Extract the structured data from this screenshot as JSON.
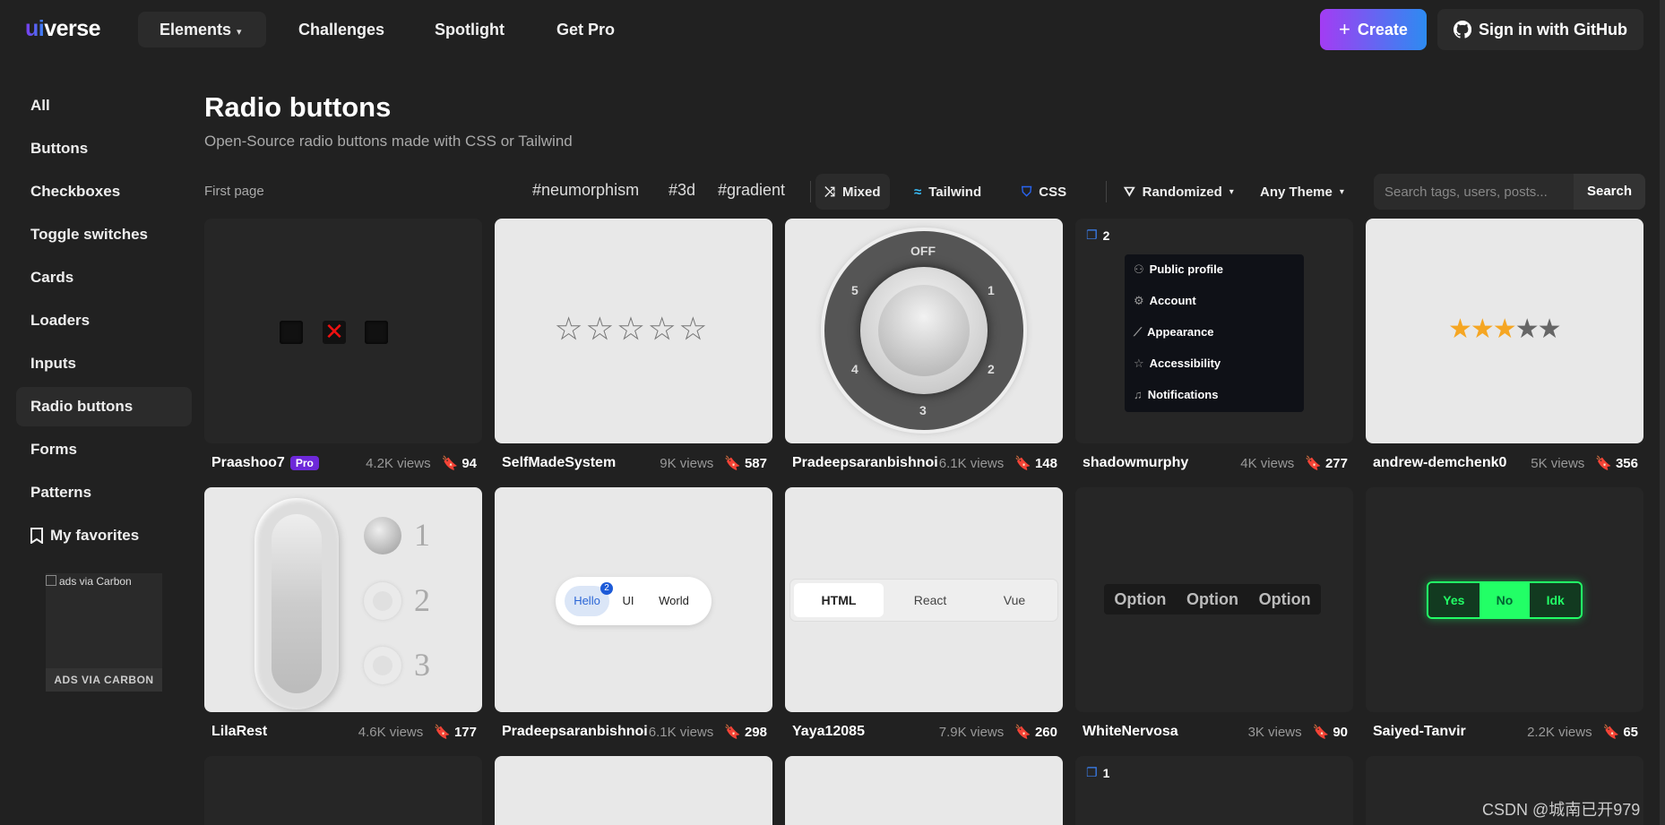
{
  "brand": {
    "logo_u": "ui",
    "logo_rest": "verse"
  },
  "nav": {
    "elements": "Elements",
    "challenges": "Challenges",
    "spotlight": "Spotlight",
    "getpro": "Get Pro"
  },
  "header": {
    "create": "Create",
    "github": "Sign in with GitHub"
  },
  "sidebar": {
    "items": [
      "All",
      "Buttons",
      "Checkboxes",
      "Toggle switches",
      "Cards",
      "Loaders",
      "Inputs",
      "Radio buttons",
      "Forms",
      "Patterns"
    ],
    "favorites": "My favorites"
  },
  "carbon": {
    "alt": "ads via Carbon",
    "footer": "ADS VIA CARBON"
  },
  "page": {
    "title": "Radio buttons",
    "subtitle": "Open-Source radio buttons made with CSS or Tailwind"
  },
  "filters": {
    "first_page": "First page",
    "tags": [
      "#neumorphism",
      "#3d",
      "#gradient"
    ],
    "mixed": "Mixed",
    "tailwind": "Tailwind",
    "css": "CSS",
    "randomized": "Randomized",
    "theme": "Any Theme",
    "search_placeholder": "Search tags, users, posts...",
    "search_button": "Search"
  },
  "cards": [
    {
      "author": "Praashoo7",
      "pro": "Pro",
      "views": "4.2K views",
      "saves": "94"
    },
    {
      "author": "SelfMadeSystem",
      "views": "9K views",
      "saves": "587"
    },
    {
      "author": "Pradeepsaranbishnoi",
      "views": "6.1K views",
      "saves": "148"
    },
    {
      "author": "shadowmurphy",
      "views": "4K views",
      "saves": "277"
    },
    {
      "author": "andrew-demchenk0",
      "views": "5K views",
      "saves": "356"
    },
    {
      "author": "LilaRest",
      "views": "4.6K views",
      "saves": "177"
    },
    {
      "author": "Pradeepsaranbishnoi",
      "views": "6.1K views",
      "saves": "298"
    },
    {
      "author": "Yaya12085",
      "views": "7.9K views",
      "saves": "260"
    },
    {
      "author": "WhiteNervosa",
      "views": "3K views",
      "saves": "90"
    },
    {
      "author": "Saiyed-Tanvir",
      "views": "2.2K views",
      "saves": "65"
    }
  ],
  "previews": {
    "knob": {
      "off": "OFF",
      "n1": "1",
      "n2": "2",
      "n3": "3",
      "n4": "4",
      "n5": "5"
    },
    "menu": {
      "count": "2",
      "items": [
        "Public profile",
        "Account",
        "Appearance",
        "Accessibility",
        "Notifications"
      ]
    },
    "stars": "★★★★★",
    "lila": {
      "n1": "1",
      "n2": "2",
      "n3": "3"
    },
    "pill": {
      "a": "Hello",
      "badge": "2",
      "b": "UI",
      "c": "World"
    },
    "tabs": {
      "a": "HTML",
      "b": "React",
      "c": "Vue"
    },
    "options": {
      "a": "Option",
      "b": "Option",
      "c": "Option"
    },
    "yn": {
      "a": "Yes",
      "b": "No",
      "c": "Idk"
    },
    "row3_count": "1"
  },
  "watermark": "CSDN @城南已开979",
  "colors": {
    "accent_from": "#a33cf3",
    "accent_to": "#2d8bf1",
    "star": "#f5a623",
    "neon": "#22ff66"
  }
}
